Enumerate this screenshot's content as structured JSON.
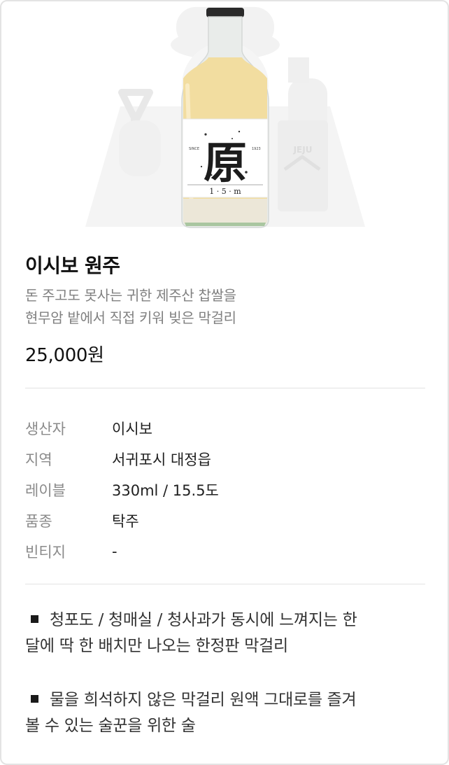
{
  "product": {
    "name": "이시보 원주",
    "description_lines": [
      "돈 주고도 못사는 귀한 제주산 찹쌀을",
      "현무암 밭에서 직접 키워 빚은 막걸리"
    ],
    "price": "25,000원",
    "image": {
      "logo_text": "原",
      "bg_badge": "JEJU",
      "label_small_left": "SINCE",
      "label_small_right": "1923",
      "label_footer": "1 · 5 · m"
    }
  },
  "specs": [
    {
      "label": "생산자",
      "value": "이시보"
    },
    {
      "label": "지역",
      "value": "서귀포시 대정읍"
    },
    {
      "label": "레이블",
      "value": "330ml / 15.5도"
    },
    {
      "label": "품종",
      "value": "탁주"
    },
    {
      "label": "빈티지",
      "value": "-"
    }
  ],
  "features": [
    {
      "lines": [
        "청포도 / 청매실 / 청사과가 동시에 느껴지는 한",
        "달에 딱 한 배치만 나오는 한정판 막걸리"
      ]
    },
    {
      "lines": [
        "물을 희석하지 않은 막걸리 원액 그대로를 즐겨",
        "볼 수 있는 술꾼을 위한 술"
      ]
    }
  ],
  "colors": {
    "text_primary": "#111111",
    "text_secondary": "#808080",
    "divider": "#e2e2e2",
    "bottle_liquid": "#f2dda0",
    "bottle_sediment": "#ece7d8",
    "watermark": "#efefef"
  }
}
